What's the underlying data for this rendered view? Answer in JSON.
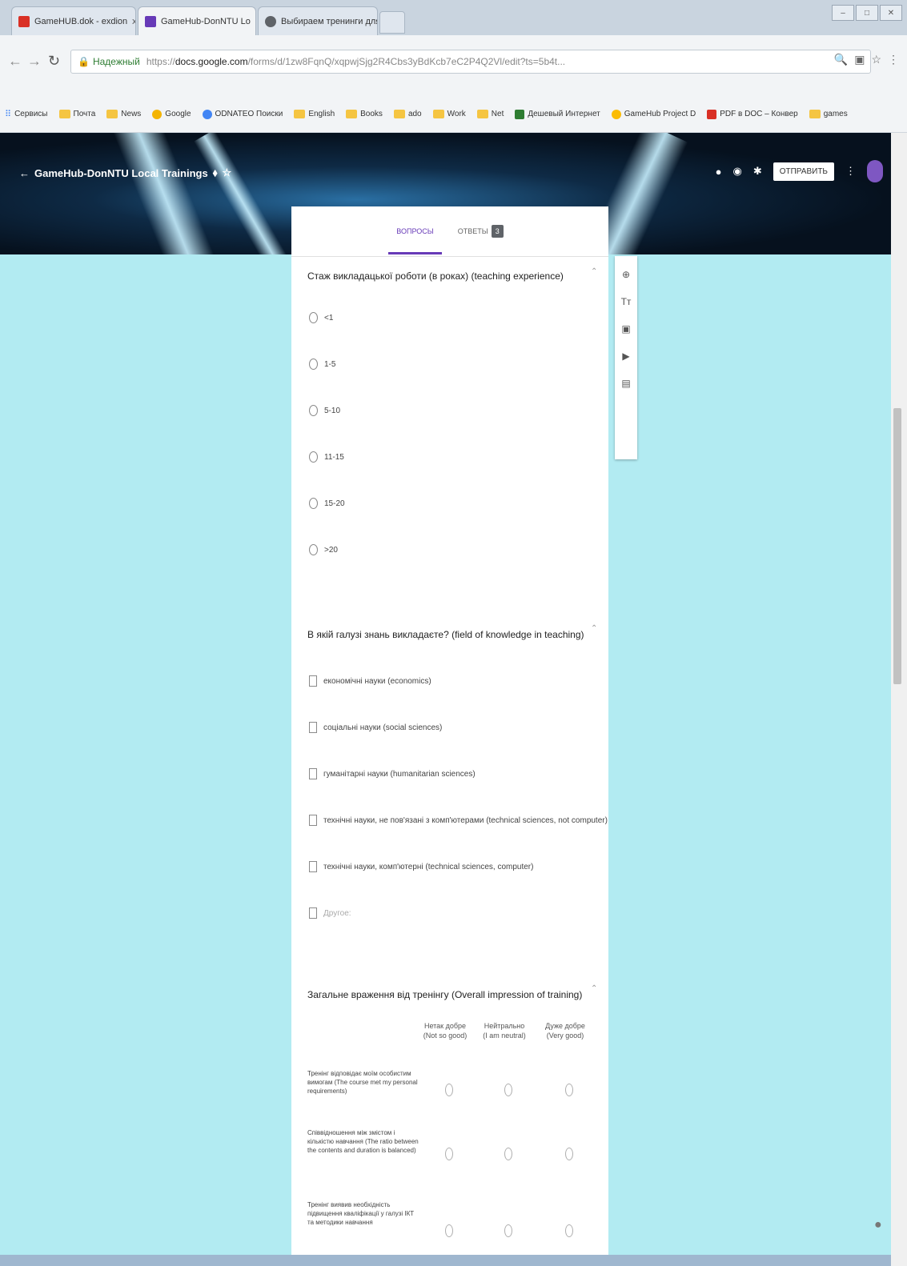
{
  "browser": {
    "tabs": [
      {
        "label": "GameHUB.dok - exdion",
        "close": "x",
        "color": "#d93025"
      },
      {
        "label": "GameHub-DonNTU Lo",
        "close": "x",
        "color": "#673ab7"
      },
      {
        "label": "Выбираем тренинги для",
        "close": "x",
        "color": "#5f6368"
      }
    ],
    "address": {
      "secure_label": "Надежный",
      "protocol": "https://",
      "host": "docs.google.com",
      "path": "/forms/d/1zw8FqnQ/xqpwjSjg2R4Cbs3yBdKcb7eC2P4Q2Vl/edit?ts=5b4t..."
    },
    "bookmarks": [
      {
        "label": "Сервисы",
        "type": "apps"
      },
      {
        "label": "Почта",
        "type": "folder"
      },
      {
        "label": "News",
        "type": "folder"
      },
      {
        "label": "Google",
        "type": "site",
        "color": "#f4b400"
      },
      {
        "label": "ODNATEO Поиски",
        "type": "site",
        "color": "#4285f4"
      },
      {
        "label": "English",
        "type": "folder"
      },
      {
        "label": "Books",
        "type": "folder"
      },
      {
        "label": "ado",
        "type": "folder"
      },
      {
        "label": "Work",
        "type": "folder"
      },
      {
        "label": "Net",
        "type": "folder"
      },
      {
        "label": "Дешевый Интернет",
        "type": "site",
        "color": "#2e7d32"
      },
      {
        "label": "GameHub Project D",
        "type": "site",
        "color": "#fbbc04"
      },
      {
        "label": "PDF в DOC – Конвер",
        "type": "site",
        "color": "#d93025"
      },
      {
        "label": "games",
        "type": "folder"
      }
    ]
  },
  "header": {
    "title": "GameHub-DonNTU Local Trainings",
    "send_label": "ОТПРАВИТЬ"
  },
  "form_tabs": {
    "questions": "ВОПРОСЫ",
    "answers": "ОТВЕТЫ",
    "answers_count": "3"
  },
  "questions": [
    {
      "title": "Стаж викладацької роботи (в роках) (teaching experience)",
      "options": [
        "<1",
        "1-5",
        "5-10",
        "11-15",
        "15-20",
        ">20"
      ]
    },
    {
      "title": "В якій галузі знань викладаєте? (field of knowledge in teaching)",
      "options": [
        "економічні науки (economics)",
        "соціальні науки (social sciences)",
        "гуманітарні науки (humanitarian sciences)",
        "технічні науки, не пов'язані з комп'ютерами (technical sciences, not computer)",
        "технічні науки, комп'ютерні (technical sciences, computer)",
        "Другое:"
      ]
    },
    {
      "title": "Загальне враження від тренінгу (Overall impression of training)",
      "columns": [
        "Нетак добре (Not so good)",
        "Нейтрально (I am neutral)",
        "Дуже добре (Very good)"
      ],
      "rows": [
        "Тренінг відповідає моїм особистим вимогам (The course met my personal requirements)",
        "Співвідношення між змістом і кількістю навчання (The ratio between the contents and duration is balanced)",
        "Тренінг виявив необхідність підвищення кваліфікації у галузі ІКТ та методики навчання"
      ]
    }
  ],
  "side_tools": [
    "add-question",
    "Tт",
    "image",
    "video",
    "section"
  ]
}
